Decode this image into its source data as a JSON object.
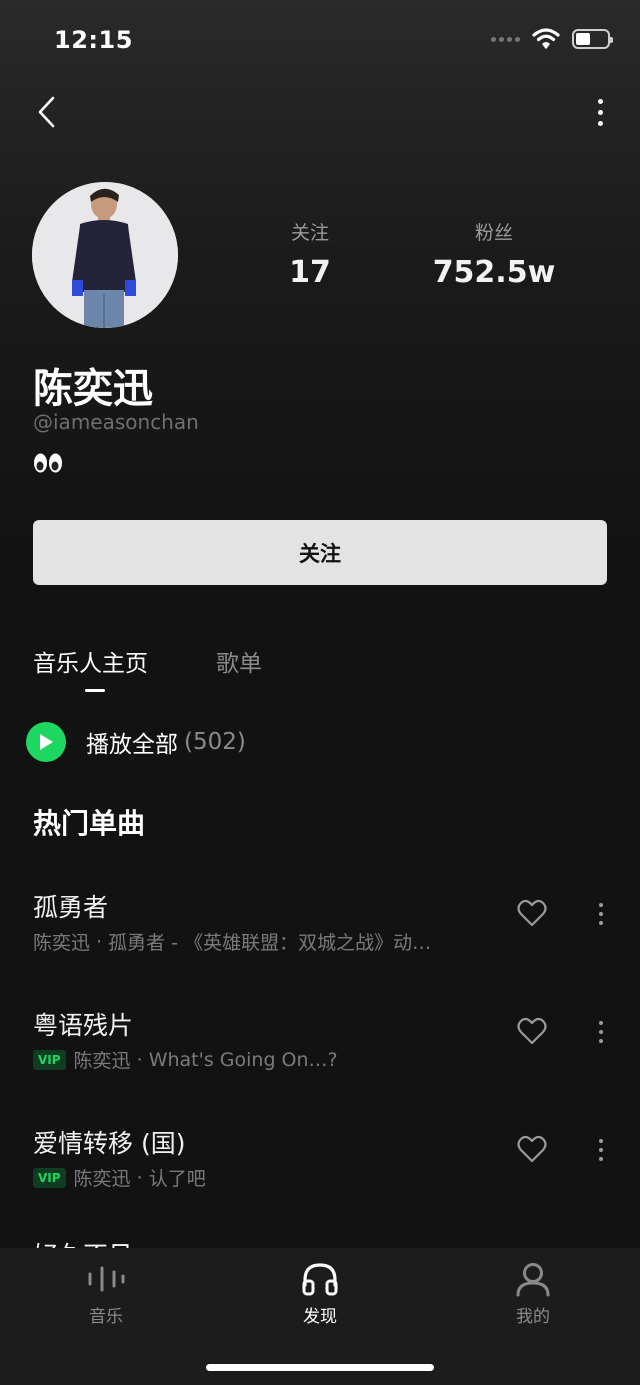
{
  "status_bar": {
    "time": "12:15",
    "battery_level": 0.45
  },
  "nav": {
    "back_icon": "chevron-left-icon",
    "more_icon": "more-vertical-icon"
  },
  "profile": {
    "name": "陈奕迅",
    "handle": "@iameasonchan",
    "bio": "👀",
    "stats": [
      {
        "label": "关注",
        "value": "17"
      },
      {
        "label": "粉丝",
        "value": "752.5w"
      }
    ],
    "follow_button": "关注"
  },
  "tabs": [
    {
      "label": "音乐人主页",
      "active": true
    },
    {
      "label": "歌单",
      "active": false
    }
  ],
  "play_all": {
    "label": "播放全部",
    "count": "(502)"
  },
  "section_title": "热门单曲",
  "songs": [
    {
      "title": "孤勇者",
      "vip": false,
      "vip_label": "",
      "artist": "陈奕迅",
      "album": "孤勇者 - 《英雄联盟：双城之战》动…"
    },
    {
      "title": "粤语残片",
      "vip": true,
      "vip_label": "VIP",
      "artist": "陈奕迅",
      "album": "What's Going On…?"
    },
    {
      "title": "爱情转移 (国)",
      "vip": true,
      "vip_label": "VIP",
      "artist": "陈奕迅",
      "album": "认了吧"
    }
  ],
  "partial_song": "好久不见",
  "bottom_nav": [
    {
      "label": "音乐",
      "icon": "equalizer-icon",
      "active": false
    },
    {
      "label": "发现",
      "icon": "headphones-icon",
      "active": true
    },
    {
      "label": "我的",
      "icon": "user-icon",
      "active": false
    }
  ],
  "colors": {
    "accent": "#1ed760",
    "background": "#121212",
    "button": "#e3e3e3"
  }
}
